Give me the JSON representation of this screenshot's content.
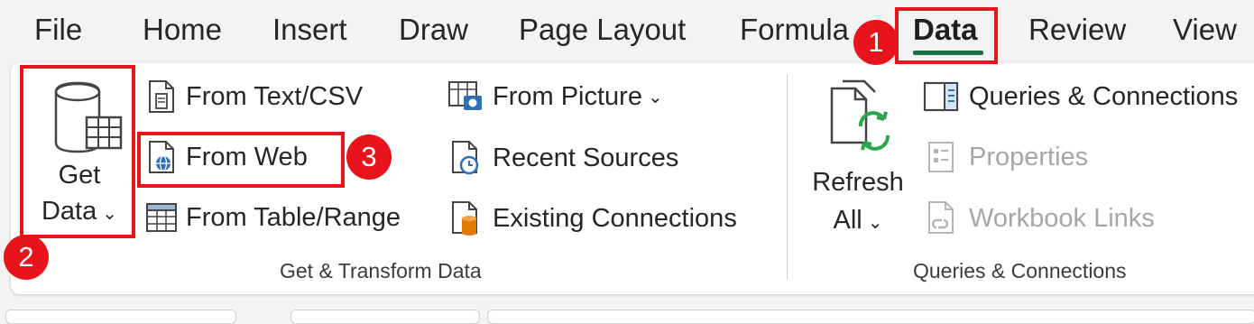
{
  "tabs": [
    {
      "label": "File"
    },
    {
      "label": "Home"
    },
    {
      "label": "Insert"
    },
    {
      "label": "Draw"
    },
    {
      "label": "Page Layout"
    },
    {
      "label": "Formula"
    },
    {
      "label": "Data",
      "active": true
    },
    {
      "label": "Review"
    },
    {
      "label": "View"
    }
  ],
  "get_transform": {
    "get_data": {
      "line1": "Get",
      "line2": "Data",
      "chevron": "⌄"
    },
    "items": {
      "from_text_csv": "From Text/CSV",
      "from_web": "From Web",
      "from_table_range": "From Table/Range",
      "from_picture": "From Picture",
      "recent_sources": "Recent Sources",
      "existing_connections": "Existing Connections"
    },
    "label": "Get & Transform Data"
  },
  "queries": {
    "refresh": {
      "line1": "Refresh",
      "line2": "All",
      "chevron": "⌄"
    },
    "items": {
      "queries_connections": "Queries & Connections",
      "properties": "Properties",
      "workbook_links": "Workbook Links"
    },
    "label": "Queries & Connections"
  },
  "annotations": {
    "step1": "1",
    "step2": "2",
    "step3": "3"
  },
  "colors": {
    "accent": "#1e7145",
    "highlight": "#e8131b",
    "icon_blue": "#2f6fb5",
    "icon_green": "#2da44e",
    "icon_orange": "#e07b00"
  },
  "icons": [
    "database-table-icon",
    "text-file-icon",
    "web-globe-icon",
    "table-icon",
    "picture-icon",
    "clock-file-icon",
    "cylinder-file-icon",
    "refresh-icon",
    "pane-icon",
    "properties-icon",
    "link-file-icon"
  ]
}
